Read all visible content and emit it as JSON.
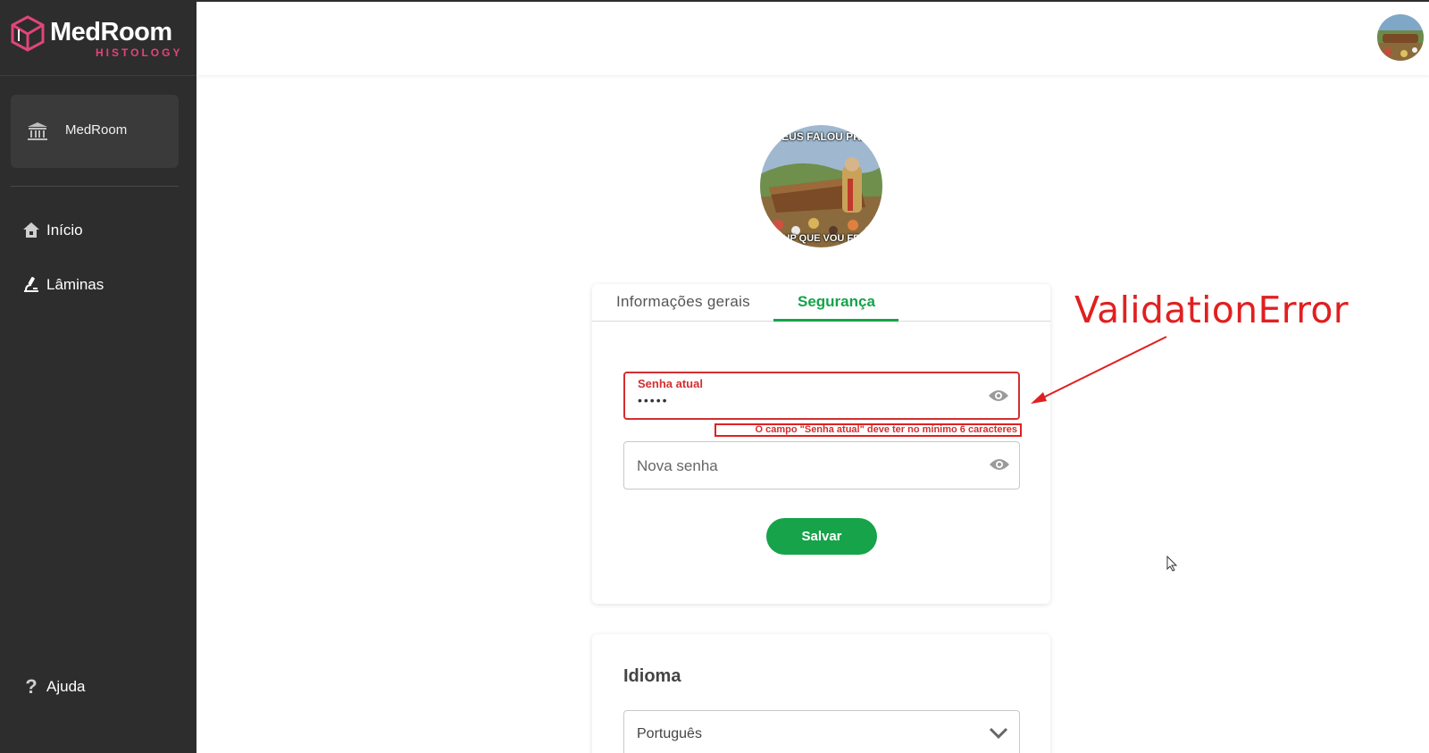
{
  "brand": {
    "name": "MedRoom",
    "subtitle": "HISTOLOGY",
    "accent_color": "#e0457b"
  },
  "sidebar": {
    "institution": {
      "label": "MedRoom",
      "icon": "institution-icon"
    },
    "items": [
      {
        "label": "Início",
        "icon": "home-icon"
      },
      {
        "label": "Lâminas",
        "icon": "microscope-icon"
      }
    ],
    "help": {
      "label": "Ajuda",
      "icon": "question-icon"
    }
  },
  "profile": {
    "avatar_caption_top": "DEUS FALOU PRA",
    "avatar_caption_bottom": "...UP QUE VOU FE..."
  },
  "tabs": [
    {
      "label": "Informações gerais",
      "active": false
    },
    {
      "label": "Segurança",
      "active": true
    }
  ],
  "security_form": {
    "current_password": {
      "label": "Senha atual",
      "value": "•••••",
      "error": "O campo \"Senha atual\" deve ter no mínimo 6 caracteres"
    },
    "new_password": {
      "placeholder": "Nova senha",
      "value": ""
    },
    "save_label": "Salvar"
  },
  "language": {
    "title": "Idioma",
    "selected": "Português"
  },
  "annotation": {
    "label": "ValidationError",
    "color": "#e02020"
  },
  "colors": {
    "sidebar_bg": "#2d2d2d",
    "primary_green": "#16a34a",
    "error_red": "#d32f2f"
  }
}
